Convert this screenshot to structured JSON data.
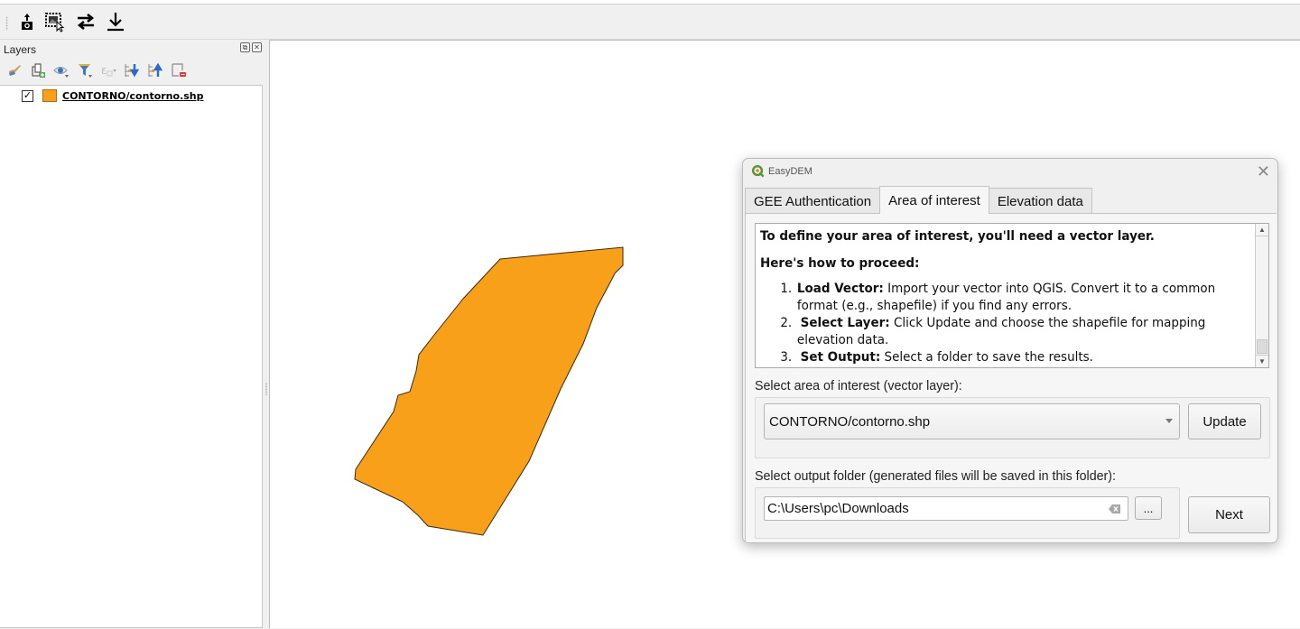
{
  "toolbar": {
    "buttons": [
      {
        "name": "upload-camera-icon"
      },
      {
        "name": "select-image-icon"
      },
      {
        "name": "swap-arrows-icon"
      },
      {
        "name": "download-icon"
      }
    ]
  },
  "layers_panel": {
    "title": "Layers",
    "float_label": "⧉",
    "close_label": "✕",
    "tools": [
      "style-manager-icon",
      "add-group-icon",
      "visibility-icon",
      "filter-legend-icon",
      "filter-expression-icon",
      "expand-all-icon",
      "collapse-all-icon",
      "remove-layer-icon"
    ],
    "layers": [
      {
        "name": "CONTORNO/contorno.shp",
        "checked": true,
        "check_mark": "✓",
        "color": "#f9a01b"
      }
    ]
  },
  "map": {
    "polygon_fill": "#f9a01b",
    "polygon_stroke": "#3a2a10"
  },
  "dialog": {
    "title": "EasyDEM",
    "close_label": "✕",
    "tabs": [
      {
        "label": "GEE Authentication",
        "active": false
      },
      {
        "label": "Area of interest",
        "active": true
      },
      {
        "label": "Elevation data",
        "active": false
      }
    ],
    "info": {
      "heading": "To define your area of interest, you'll need a vector layer.",
      "subheading": "Here's how to proceed:",
      "steps": [
        {
          "num": "1.",
          "title": "Load Vector:",
          "text": " Import your vector into QGIS. Convert it to a common format (e.g., shapefile) if you find any errors."
        },
        {
          "num": "2.",
          "title": "Select Layer:",
          "text": " Click Update and choose the shapefile for mapping elevation data."
        },
        {
          "num": "3.",
          "title": "Set Output:",
          "text": " Select a folder to save the results."
        }
      ],
      "scroll_up": "▲",
      "scroll_down": "▼"
    },
    "aoi_label": "Select area of interest (vector layer):",
    "aoi_selected": "CONTORNO/contorno.shp",
    "update_label": "Update",
    "output_label": "Select output folder (generated files will be saved in this folder):",
    "output_value": "C:\\Users\\pc\\Downloads",
    "browse_label": "...",
    "next_label": "Next"
  }
}
